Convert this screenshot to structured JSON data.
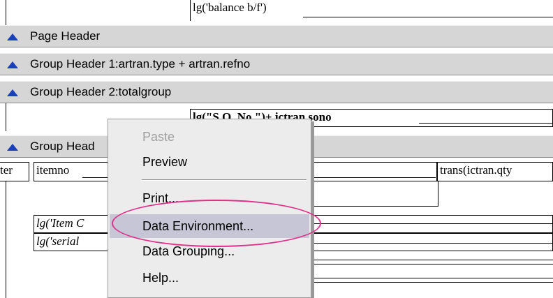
{
  "report": {
    "top_field": "lg('balance b/f')",
    "bands": {
      "page_header": "Page Header",
      "group_header_1": "Group Header 1:artran.type +  artran.refno",
      "group_header_2": "Group Header 2:totalgroup",
      "group_header_partial": "Group Head"
    },
    "fields": {
      "so_field": "lg(\"S.O. No.\")+ ictran.sono",
      "ter_field": "ter",
      "itemno_field": "itemno",
      "trans_field": "trans(ictran.qty",
      "item_label": "lg('Item C",
      "serial_label": "lg('serial"
    }
  },
  "context_menu": {
    "items": [
      {
        "label": "Paste",
        "enabled": false
      },
      {
        "label": "Preview",
        "enabled": true
      },
      {
        "label": "Print...",
        "enabled": true
      },
      {
        "label": "Data Environment...",
        "enabled": true,
        "highlighted": true
      },
      {
        "label": "Data Grouping...",
        "enabled": true
      },
      {
        "label": "Help...",
        "enabled": true
      }
    ]
  },
  "annotation": {
    "ellipse_color": "#e0308a"
  },
  "colors": {
    "band_bg": "#d6d6d6",
    "triangle": "#1a3fb8",
    "menu_bg": "#ececec"
  }
}
